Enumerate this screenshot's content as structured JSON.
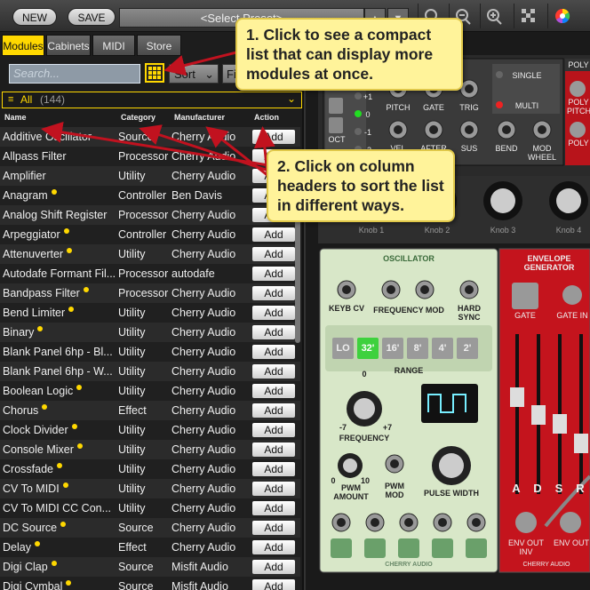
{
  "toolbar": {
    "new_label": "NEW",
    "save_label": "SAVE",
    "preset_label": "<Select Preset>"
  },
  "tabs": [
    {
      "label": "Modules",
      "active": true
    },
    {
      "label": "Cabinets",
      "active": false
    },
    {
      "label": "MIDI",
      "active": false
    },
    {
      "label": "Store",
      "active": false
    }
  ],
  "search": {
    "placeholder": "Search..."
  },
  "sort": {
    "label": "Sort",
    "filter_label": "Fil"
  },
  "filter": {
    "label": "All",
    "count": "(144)"
  },
  "columns": {
    "name": "Name",
    "category": "Category",
    "manufacturer": "Manufacturer",
    "action": "Action"
  },
  "modules": [
    {
      "name": "Additive Oscillator",
      "category": "Source",
      "manufacturer": "Cherry Audio",
      "action": "Add",
      "new": false
    },
    {
      "name": "Allpass Filter",
      "category": "Processor",
      "manufacturer": "Cherry Audio",
      "action": "Add",
      "new": false
    },
    {
      "name": "Amplifier",
      "category": "Utility",
      "manufacturer": "Cherry Audio",
      "action": "Add",
      "new": false
    },
    {
      "name": "Anagram",
      "category": "Controller",
      "manufacturer": "Ben Davis",
      "action": "Add",
      "new": true
    },
    {
      "name": "Analog Shift Register",
      "category": "Processor",
      "manufacturer": "Cherry Audio",
      "action": "Add",
      "new": false
    },
    {
      "name": "Arpeggiator",
      "category": "Controller",
      "manufacturer": "Cherry Audio",
      "action": "Add",
      "new": true
    },
    {
      "name": "Attenuverter",
      "category": "Utility",
      "manufacturer": "Cherry Audio",
      "action": "Add",
      "new": true
    },
    {
      "name": "Autodafe Formant Fil...",
      "category": "Processor",
      "manufacturer": "autodafe",
      "action": "Add",
      "new": false
    },
    {
      "name": "Bandpass Filter",
      "category": "Processor",
      "manufacturer": "Cherry Audio",
      "action": "Add",
      "new": true
    },
    {
      "name": "Bend Limiter",
      "category": "Utility",
      "manufacturer": "Cherry Audio",
      "action": "Add",
      "new": true
    },
    {
      "name": "Binary",
      "category": "Utility",
      "manufacturer": "Cherry Audio",
      "action": "Add",
      "new": true
    },
    {
      "name": "Blank Panel 6hp - Bl...",
      "category": "Utility",
      "manufacturer": "Cherry Audio",
      "action": "Add",
      "new": false
    },
    {
      "name": "Blank Panel 6hp - W...",
      "category": "Utility",
      "manufacturer": "Cherry Audio",
      "action": "Add",
      "new": false
    },
    {
      "name": "Boolean Logic",
      "category": "Utility",
      "manufacturer": "Cherry Audio",
      "action": "Add",
      "new": true
    },
    {
      "name": "Chorus",
      "category": "Effect",
      "manufacturer": "Cherry Audio",
      "action": "Add",
      "new": true
    },
    {
      "name": "Clock Divider",
      "category": "Utility",
      "manufacturer": "Cherry Audio",
      "action": "Add",
      "new": true
    },
    {
      "name": "Console Mixer",
      "category": "Utility",
      "manufacturer": "Cherry Audio",
      "action": "Add",
      "new": true
    },
    {
      "name": "Crossfade",
      "category": "Utility",
      "manufacturer": "Cherry Audio",
      "action": "Add",
      "new": true
    },
    {
      "name": "CV To MIDI",
      "category": "Utility",
      "manufacturer": "Cherry Audio",
      "action": "Add",
      "new": true
    },
    {
      "name": "CV To MIDI CC Con...",
      "category": "Utility",
      "manufacturer": "Cherry Audio",
      "action": "Add",
      "new": false
    },
    {
      "name": "DC Source",
      "category": "Source",
      "manufacturer": "Cherry Audio",
      "action": "Add",
      "new": true
    },
    {
      "name": "Delay",
      "category": "Effect",
      "manufacturer": "Cherry Audio",
      "action": "Add",
      "new": true
    },
    {
      "name": "Digi Clap",
      "category": "Source",
      "manufacturer": "Misfit Audio",
      "action": "Add",
      "new": true
    },
    {
      "name": "Digi Cymbal",
      "category": "Source",
      "manufacturer": "Misfit Audio",
      "action": "Add",
      "new": true
    }
  ],
  "callouts": {
    "one": "1. Click to see a compact list that can display more modules at once.",
    "two": "2. Click on column headers to sort the list in different ways."
  },
  "rack": {
    "oct_label": "OCT",
    "oct_values": [
      "+1",
      "0",
      "-1",
      "-2"
    ],
    "midi_labels": [
      "PITCH",
      "GATE",
      "TRIG",
      "VEL",
      "AFTER",
      "SUS",
      "BEND",
      "MOD WHEEL"
    ],
    "single_label": "SINGLE",
    "multi_label": "MULTI",
    "poly_label": "POLY",
    "poly_pitch": "POLY PITCH",
    "poly_gate": "POLY",
    "knobs": [
      "Knob 1",
      "Knob 2",
      "Knob 3",
      "Knob 4"
    ],
    "osc": {
      "title": "OSCILLATOR",
      "keyb_cv": "KEYB CV",
      "freq_mod": "FREQUENCY MOD",
      "hard_sync": "HARD SYNC",
      "range_buttons": [
        "LO",
        "32'",
        "16'",
        "8'",
        "4'",
        "2'"
      ],
      "range_label": "RANGE",
      "frequency": "FREQUENCY",
      "freq_min": "-7",
      "freq_max": "+7",
      "freq_zero": "0",
      "pwm_amount": "PWM AMOUNT",
      "pwm_mod": "PWM MOD",
      "pulse_width": "PULSE WIDTH",
      "pwm_min": "0",
      "pwm_max": "10",
      "brand": "CHERRY AUDIO"
    },
    "env": {
      "title": "ENVELOPE GENERATOR",
      "gate": "GATE",
      "gate_in": "GATE IN",
      "adsr": [
        "A",
        "D",
        "S",
        "R"
      ],
      "env_out_inv": "ENV OUT INV",
      "env_out": "ENV OUT",
      "brand": "CHERRY AUDIO"
    }
  },
  "colors": {
    "accent": "#ffd800",
    "callout_bg": "#fff39a",
    "env_red": "#c4141d",
    "osc_green": "#d8e7c8"
  }
}
